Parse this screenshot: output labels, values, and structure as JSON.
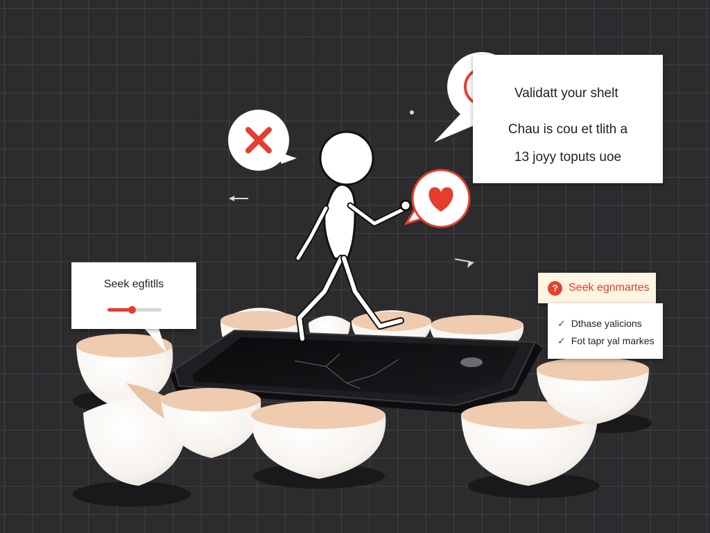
{
  "validate_card": {
    "title": "Validatt your shelt",
    "line_2": "Chau is cou et tlith a",
    "line_3": "13 joyy toputs uoe"
  },
  "seek_card": {
    "label": "Seek egfitlls",
    "slider_value": 0.45
  },
  "markers_card": {
    "header": "Seek egnmartes",
    "items": [
      "Dthase yalicions",
      "Fot tapr yal markes"
    ]
  },
  "colors": {
    "background": "#2c2b2d",
    "accent_red": "#e53e2e",
    "card_white": "#ffffff",
    "header_cream": "#fdf4e1",
    "egg_shell": "#f9f6f1",
    "egg_yolk": "#efcbb0",
    "phone_body": "#141416",
    "check_blue": "#234a8c"
  },
  "icons": {
    "validate": "checkmark-circle-icon",
    "reject": "close-x-icon",
    "favorite": "heart-icon",
    "help": "question-icon",
    "check": "check-icon"
  }
}
